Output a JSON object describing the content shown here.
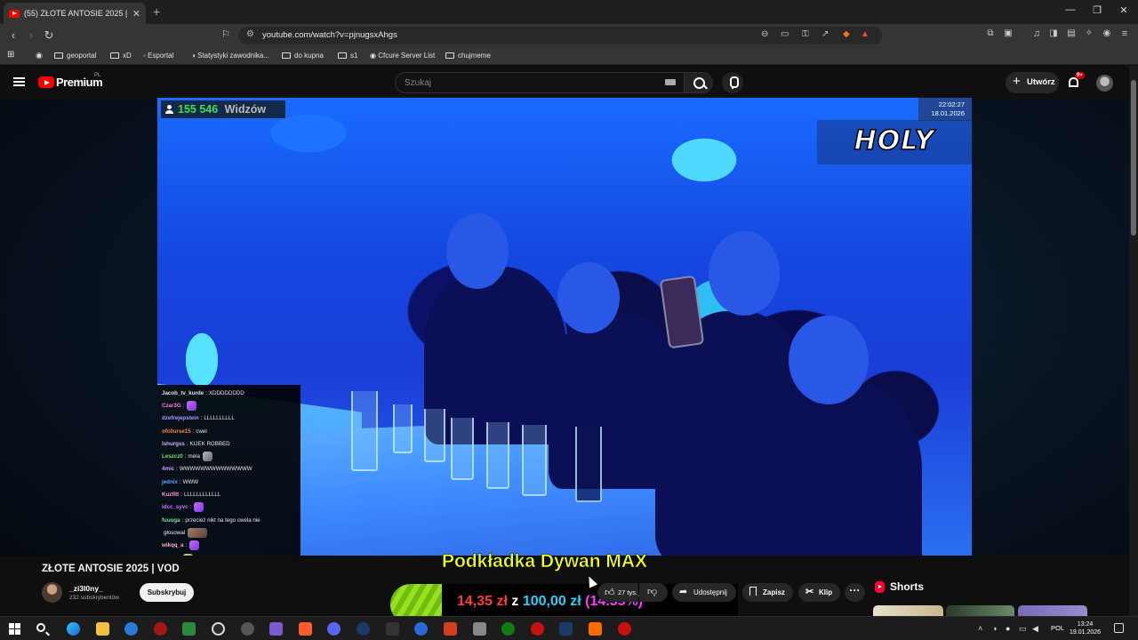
{
  "browser": {
    "tab_title": "(55) ZŁOTE ANTOSIE 2025 | V",
    "new_tab": "+",
    "url": "youtube.com/watch?v=pjnugsxAhgs",
    "bookmarks": [
      "geoportal",
      "xD",
      "Esportal",
      "Statystyki zawodnika...",
      "do kupna",
      "s1",
      "Cfcure Server List",
      "chujmeme"
    ]
  },
  "youtube": {
    "logo_text": "Premium",
    "logo_region": "PL",
    "search_placeholder": "Szukaj",
    "create_label": "Utwórz",
    "notification_count": "9+"
  },
  "video": {
    "viewers_count": "155 546",
    "viewers_label": "Widzów",
    "stamp_time": "22:02:27",
    "stamp_date": "18.01.2026",
    "watermark": "HOLY"
  },
  "chat": [
    {
      "user": "Jacob_tv_kurde",
      "color": "#e0e0e0",
      "text": "XDDDDDDDD",
      "emote": ""
    },
    {
      "user": "Czar3G",
      "color": "#ff7ae0",
      "text": "",
      "emote": "purple"
    },
    {
      "user": "dzefrejepstein",
      "color": "#a0a0ff",
      "text": "LLLLLLLLLL",
      "emote": ""
    },
    {
      "user": "ofc0urse15",
      "color": "#ff8050",
      "text": "cwel",
      "emote": ""
    },
    {
      "user": "lshurgss",
      "color": "#d0b0ff",
      "text": "KIJEK ROBBED",
      "emote": ""
    },
    {
      "user": "Leszcz0",
      "color": "#70e070",
      "text": "mela",
      "emote": "grey"
    },
    {
      "user": "4mic",
      "color": "#c0a0ff",
      "text": "WWWWWWWWWWWWWW",
      "emote": ""
    },
    {
      "user": "jednix",
      "color": "#60a0ff",
      "text": "WWW",
      "emote": ""
    },
    {
      "user": "Kuzfitt",
      "color": "#ff9fd0",
      "text": "LLLLLLLLLLLL",
      "emote": ""
    },
    {
      "user": "idcc_syvc",
      "color": "#d070ff",
      "text": "",
      "emote": "purple"
    },
    {
      "user": "fuuuga",
      "color": "#70e0a0",
      "text": "przecież nikt na tego cwela nie",
      "emote": ""
    },
    {
      "user": "",
      "color": "#e0e0e0",
      "text": "głosował",
      "emote": "brown"
    },
    {
      "user": "wikqq_a",
      "color": "#ffb0b0",
      "text": "",
      "emote": "purple"
    },
    {
      "user": "kzdqz",
      "color": "#ff6060",
      "text": "",
      "emote": "yellow"
    }
  ],
  "below": {
    "title": "ZŁOTE ANTOSIE 2025 | VOD",
    "channel_name": "_zi3l0ny_",
    "channel_subs": "232 subskrybentów",
    "subscribe_label": "Subskrybuj",
    "like_count": "27 tys.",
    "like_icon": "thumb-up-icon",
    "share_label": "Udostępnij",
    "save_label": "Zapisz",
    "clip_label": "Klip",
    "more_label": "···",
    "shorts_label": "Shorts"
  },
  "promo": {
    "title": "Podkładka Dywan MAX",
    "amount": "14,35 zł",
    "joiner": "z",
    "target": "100,00 zł",
    "percent": "(14.35%)",
    "progress": 0.1435
  },
  "taskbar": {
    "lang": "POL",
    "time": "13:24",
    "date": "19.01.2026"
  }
}
